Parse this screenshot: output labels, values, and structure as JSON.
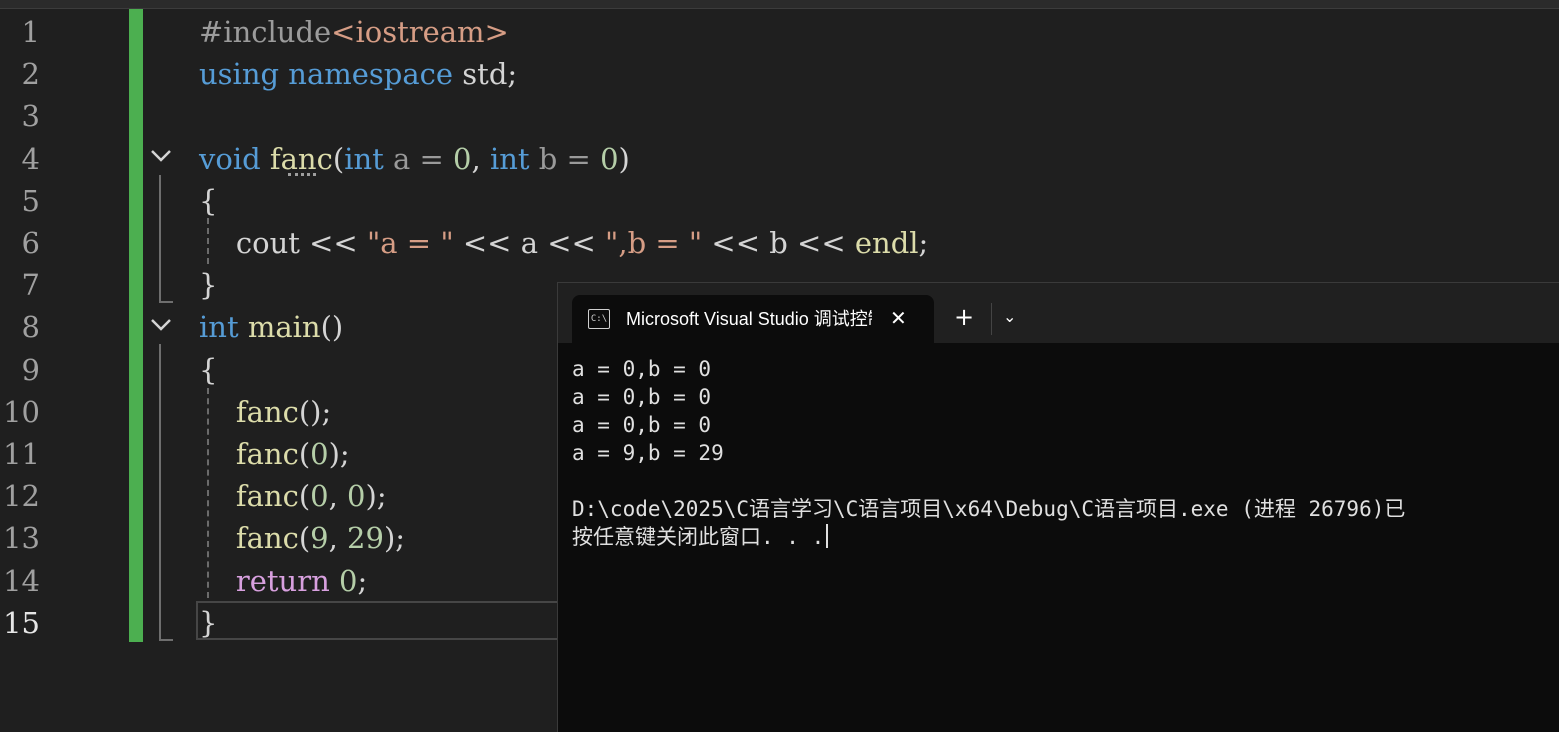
{
  "editor": {
    "lines": [
      {
        "n": "1",
        "tokens": [
          {
            "t": "#include",
            "c": "pre"
          },
          {
            "t": "<iostream>",
            "c": "inc"
          }
        ]
      },
      {
        "n": "2",
        "tokens": [
          {
            "t": "using",
            "c": "kw"
          },
          {
            "t": " ",
            "c": "pl"
          },
          {
            "t": "namespace",
            "c": "kw"
          },
          {
            "t": " std;",
            "c": "pl"
          }
        ]
      },
      {
        "n": "3",
        "tokens": []
      },
      {
        "n": "4",
        "tokens": [
          {
            "t": "void",
            "c": "kw"
          },
          {
            "t": " ",
            "c": "pl"
          },
          {
            "t": "fanc",
            "c": "fn"
          },
          {
            "t": "(",
            "c": "pl"
          },
          {
            "t": "int",
            "c": "kw"
          },
          {
            "t": " a = ",
            "c": "par"
          },
          {
            "t": "0",
            "c": "num"
          },
          {
            "t": ", ",
            "c": "pl"
          },
          {
            "t": "int",
            "c": "kw"
          },
          {
            "t": " b = ",
            "c": "par"
          },
          {
            "t": "0",
            "c": "num"
          },
          {
            "t": ")",
            "c": "pl"
          }
        ]
      },
      {
        "n": "5",
        "tokens": [
          {
            "t": "{",
            "c": "pl"
          }
        ]
      },
      {
        "n": "6",
        "tokens": [
          {
            "t": "    cout << ",
            "c": "pl"
          },
          {
            "t": "\"a = \"",
            "c": "str"
          },
          {
            "t": " << a << ",
            "c": "pl"
          },
          {
            "t": "\",b = \"",
            "c": "str"
          },
          {
            "t": " << b << ",
            "c": "pl"
          },
          {
            "t": "endl",
            "c": "fn"
          },
          {
            "t": ";",
            "c": "pl"
          }
        ]
      },
      {
        "n": "7",
        "tokens": [
          {
            "t": "}",
            "c": "pl"
          }
        ]
      },
      {
        "n": "8",
        "tokens": [
          {
            "t": "int",
            "c": "kw"
          },
          {
            "t": " ",
            "c": "pl"
          },
          {
            "t": "main",
            "c": "fn"
          },
          {
            "t": "()",
            "c": "pl"
          }
        ]
      },
      {
        "n": "9",
        "tokens": [
          {
            "t": "{",
            "c": "pl"
          }
        ]
      },
      {
        "n": "10",
        "tokens": [
          {
            "t": "    ",
            "c": "pl"
          },
          {
            "t": "fanc",
            "c": "fn"
          },
          {
            "t": "();",
            "c": "pl"
          }
        ]
      },
      {
        "n": "11",
        "tokens": [
          {
            "t": "    ",
            "c": "pl"
          },
          {
            "t": "fanc",
            "c": "fn"
          },
          {
            "t": "(",
            "c": "pl"
          },
          {
            "t": "0",
            "c": "num"
          },
          {
            "t": ");",
            "c": "pl"
          }
        ]
      },
      {
        "n": "12",
        "tokens": [
          {
            "t": "    ",
            "c": "pl"
          },
          {
            "t": "fanc",
            "c": "fn"
          },
          {
            "t": "(",
            "c": "pl"
          },
          {
            "t": "0",
            "c": "num"
          },
          {
            "t": ", ",
            "c": "pl"
          },
          {
            "t": "0",
            "c": "num"
          },
          {
            "t": ");",
            "c": "pl"
          }
        ]
      },
      {
        "n": "13",
        "tokens": [
          {
            "t": "    ",
            "c": "pl"
          },
          {
            "t": "fanc",
            "c": "fn"
          },
          {
            "t": "(",
            "c": "pl"
          },
          {
            "t": "9",
            "c": "num"
          },
          {
            "t": ", ",
            "c": "pl"
          },
          {
            "t": "29",
            "c": "num"
          },
          {
            "t": ");",
            "c": "pl"
          }
        ]
      },
      {
        "n": "14",
        "tokens": [
          {
            "t": "    ",
            "c": "pl"
          },
          {
            "t": "return",
            "c": "ret"
          },
          {
            "t": " ",
            "c": "pl"
          },
          {
            "t": "0",
            "c": "num"
          },
          {
            "t": ";",
            "c": "pl"
          }
        ]
      },
      {
        "n": "15",
        "tokens": [
          {
            "t": "}",
            "c": "pl"
          }
        ]
      }
    ],
    "current_line": "15",
    "fold_icons": [
      "chevron-down-icon",
      "chevron-down-icon"
    ]
  },
  "console": {
    "tab_title": "Microsoft Visual Studio 调试控制台",
    "tab_icon_text": "C:\\",
    "close_symbol": "✕",
    "new_tab_symbol": "+",
    "dropdown_symbol": "⌄",
    "output_lines": [
      "a = 0,b = 0",
      "a = 0,b = 0",
      "a = 0,b = 0",
      "a = 9,b = 29",
      "",
      "D:\\code\\2025\\C语言学习\\C语言项目\\x64\\Debug\\C语言项目.exe (进程 26796)已",
      "按任意键关闭此窗口. . ."
    ]
  },
  "colors": {
    "keyword": "#569cd6",
    "function": "#dcdcaa",
    "number": "#b5cea8",
    "string": "#d69d85",
    "return_keyword": "#d8a0df",
    "change_bar": "#4caf50",
    "editor_bg": "#1f1f1f",
    "console_bg": "#0c0c0c"
  }
}
